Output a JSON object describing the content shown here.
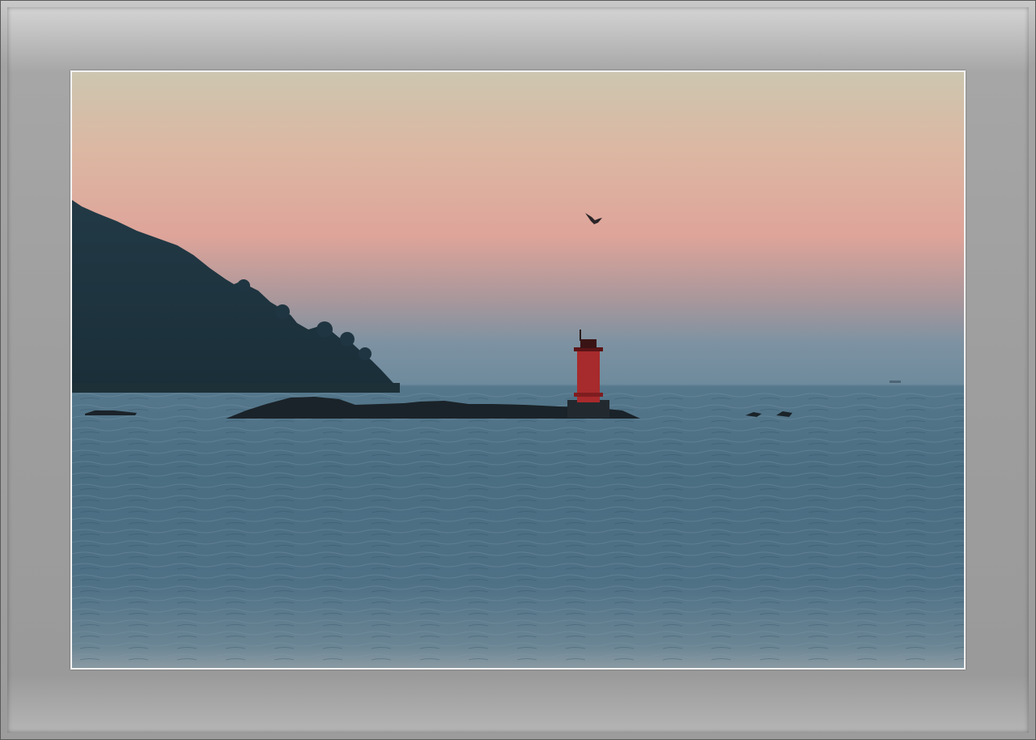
{
  "image": {
    "subject": "seascape-lighthouse-sunset",
    "colors": {
      "sky_top": "#cfc4ad",
      "sky_mid": "#e0a89b",
      "sky_horizon": "#6f8ea0",
      "sea": "#4d6f85",
      "headland": "#1d3340",
      "lighthouse": "#b0262b",
      "rocks": "#1a2229",
      "frame_mat": "#9e9e9e"
    }
  }
}
